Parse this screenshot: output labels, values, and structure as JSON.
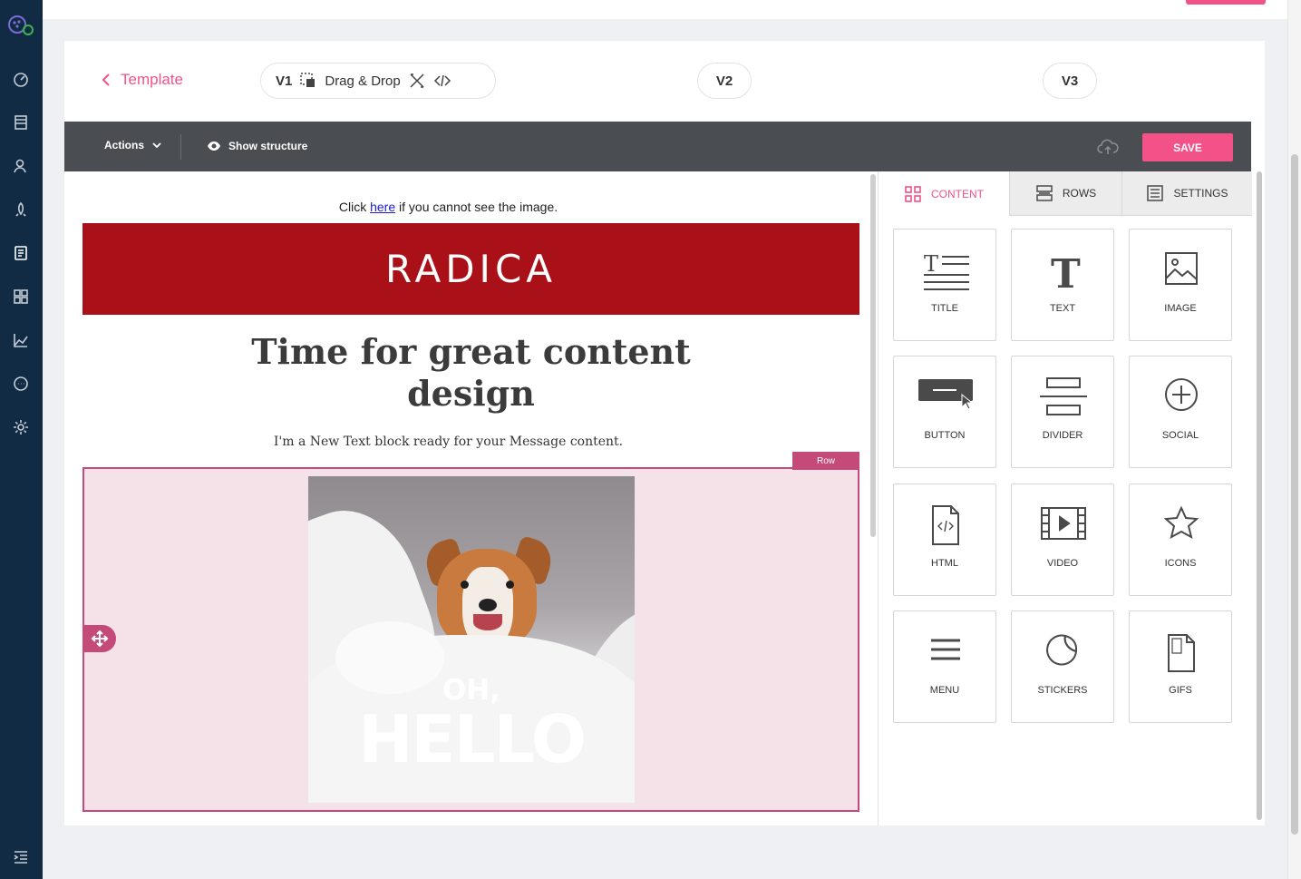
{
  "header": {
    "back_label": "Template",
    "versions": [
      {
        "label": "V1",
        "mode": "Drag & Drop"
      },
      {
        "label": "V2"
      },
      {
        "label": "V3"
      }
    ]
  },
  "toolbar": {
    "actions_label": "Actions",
    "structure_label": "Show structure",
    "save_label": "SAVE"
  },
  "email": {
    "click_prefix": "Click",
    "click_link": "here",
    "click_suffix": "if you cannot see the image.",
    "brand": "RADICA",
    "headline": "Time for great content design",
    "subline": "I'm a New Text block ready for your Message content.",
    "row_tag": "Row",
    "gif_line1": "OH,",
    "gif_line2": "HELLO"
  },
  "panel": {
    "tabs": [
      {
        "label": "CONTENT",
        "icon": "grid-icon"
      },
      {
        "label": "ROWS",
        "icon": "rows-icon"
      },
      {
        "label": "SETTINGS",
        "icon": "settings-list-icon"
      }
    ],
    "tiles": [
      {
        "label": "TITLE"
      },
      {
        "label": "TEXT"
      },
      {
        "label": "IMAGE"
      },
      {
        "label": "BUTTON"
      },
      {
        "label": "DIVIDER"
      },
      {
        "label": "SOCIAL"
      },
      {
        "label": "HTML"
      },
      {
        "label": "VIDEO"
      },
      {
        "label": "ICONS"
      },
      {
        "label": "MENU"
      },
      {
        "label": "STICKERS"
      },
      {
        "label": "GIFS"
      }
    ]
  },
  "colors": {
    "accent": "#f25287",
    "nav_bg": "#112b45",
    "toolbar_bg": "#4a4e52",
    "brand_red": "#a91017",
    "row_highlight": "#c34a79"
  }
}
